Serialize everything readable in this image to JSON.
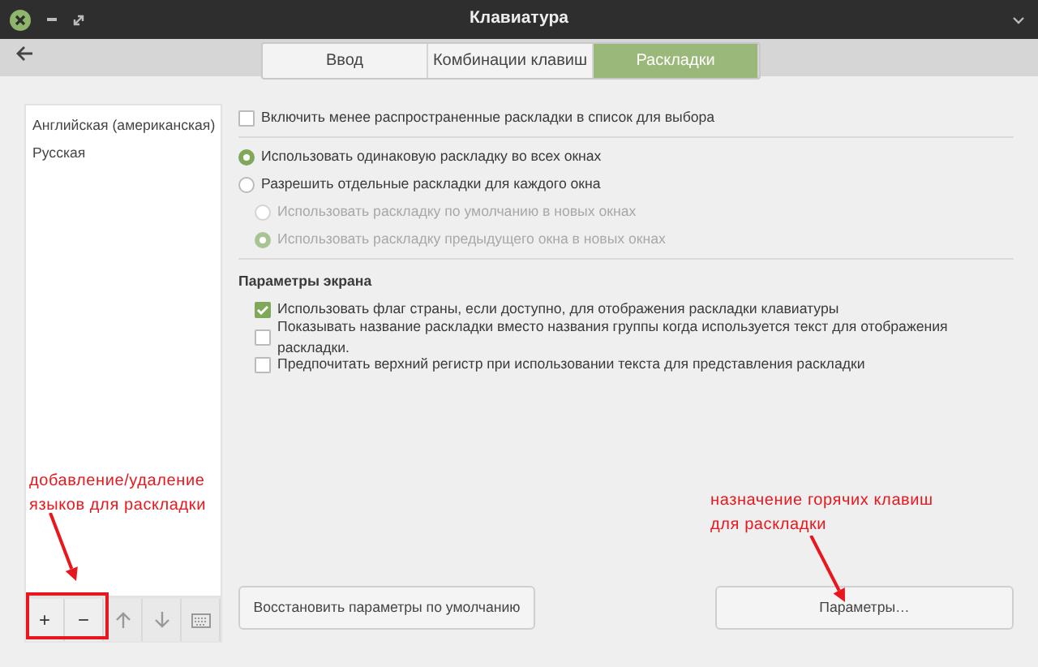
{
  "window": {
    "title": "Клавиатура"
  },
  "tabs": [
    {
      "label": "Ввод",
      "selected": false
    },
    {
      "label": "Комбинации клавиш",
      "selected": false
    },
    {
      "label": "Раскладки",
      "selected": true
    }
  ],
  "layouts": [
    {
      "label": "Английская (американская)",
      "selected": false
    },
    {
      "label": "Русская",
      "selected": false
    }
  ],
  "list_toolbar": [
    {
      "kind": "add",
      "label": "+",
      "disabled": false
    },
    {
      "kind": "remove",
      "label": "−",
      "disabled": false
    },
    {
      "kind": "up",
      "disabled": true
    },
    {
      "kind": "down",
      "disabled": true
    },
    {
      "kind": "keyboard",
      "disabled": true
    }
  ],
  "options": [
    {
      "kind": "checkbox",
      "label": "Включить менее распространенные раскладки в список для выбора",
      "checked": false,
      "disabled": false
    },
    {
      "kind": "separator"
    },
    {
      "kind": "radio",
      "label": "Использовать одинаковую раскладку во всех окнах",
      "selected": true,
      "disabled": false
    },
    {
      "kind": "radio",
      "label": "Разрешить отдельные раскладки для каждого окна",
      "selected": false,
      "disabled": false,
      "children": [
        {
          "kind": "radio",
          "label": "Использовать раскладку по умолчанию в новых окнах",
          "selected": false,
          "disabled": true
        },
        {
          "kind": "radio",
          "label": "Использовать раскладку предыдущего окна в новых окнах",
          "selected": true,
          "disabled": true
        }
      ]
    },
    {
      "kind": "separator"
    },
    {
      "kind": "heading",
      "label": "Параметры экрана",
      "children": [
        {
          "kind": "checkbox",
          "label": "Использовать флаг страны, если доступно, для отображения раскладки клавиатуры",
          "checked": true,
          "disabled": false
        },
        {
          "kind": "checkbox",
          "label": "Показывать название раскладки вместо названия группы когда используется текст для отображения раскладки.",
          "checked": false,
          "disabled": false
        },
        {
          "kind": "checkbox",
          "label": "Предпочитать верхний регистр при использовании текста для представления раскладки",
          "checked": false,
          "disabled": false
        }
      ]
    }
  ],
  "buttons": [
    {
      "label": "Восстановить параметры по умолчанию"
    },
    {
      "label": "Параметры…"
    }
  ],
  "annotations": [
    {
      "lines": [
        "добавление/удаление",
        "языков для раскладки"
      ]
    },
    {
      "lines": [
        "назначение горячих клавиш",
        "для раскладки"
      ]
    }
  ]
}
